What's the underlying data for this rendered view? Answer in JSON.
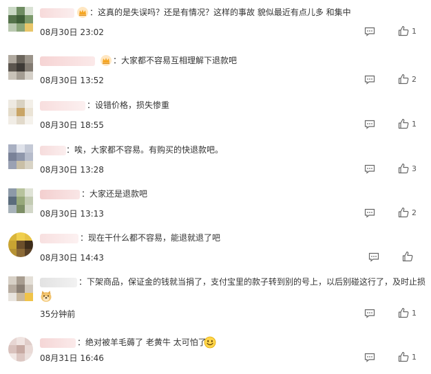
{
  "comments": [
    {
      "text": "：这真的是失误吗？还是有情况？这样的事故 貌似最近有点儿多 和集中",
      "time": "08月30日 23:02",
      "likes": "1"
    },
    {
      "text": "：大家都不容易互相理解下退款吧",
      "time": "08月30日 13:52",
      "likes": "2"
    },
    {
      "text": "：设错价格，损失惨重",
      "time": "08月30日 18:55",
      "likes": "1"
    },
    {
      "text": "：唉，大家都不容易。有购买的快退款吧。",
      "time": "08月30日 13:28",
      "likes": "3"
    },
    {
      "text": "：大家还是退款吧",
      "time": "08月30日 13:13",
      "likes": "2"
    },
    {
      "text": "：现在干什么都不容易，能退就退了吧",
      "time": "08月30日 14:43",
      "likes": ""
    },
    {
      "text": "：下架商品，保证金的钱就当捐了，支付宝里的款子转到别的号上，以后别碰这行了，及时止损",
      "time": "35分钟前",
      "likes": "1"
    },
    {
      "text": "：绝对被羊毛薅了 老黄牛 太可怕了",
      "time": "08月31日 16:46",
      "likes": "1"
    }
  ],
  "icons": {
    "reply": "comment-icon",
    "like": "thumb-up-icon",
    "badge": "crown-icon",
    "emoji_dog": "doge-emoji-icon",
    "emoji_smile": "smile-emoji-icon"
  },
  "colors": {
    "crown_bg": "#ffe7c2",
    "crown": "#f5a623",
    "icon": "#666666"
  }
}
